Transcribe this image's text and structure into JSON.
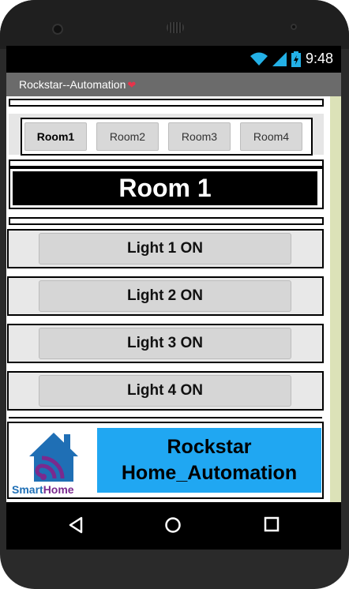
{
  "status": {
    "time": "9:48",
    "icons": [
      "wifi-icon",
      "signal-icon",
      "battery-icon"
    ]
  },
  "app": {
    "title": "Rockstar--Automation",
    "title_icon": "heart-icon"
  },
  "rooms": {
    "tabs": [
      {
        "label": "Room1",
        "active": true
      },
      {
        "label": "Room2",
        "active": false
      },
      {
        "label": "Room3",
        "active": false
      },
      {
        "label": "Room4",
        "active": false
      }
    ],
    "current_title": "Room 1"
  },
  "lights": [
    {
      "label": "Light 1 ON"
    },
    {
      "label": "Light 2 ON"
    },
    {
      "label": "Light 3 ON"
    },
    {
      "label": "Light 4 ON"
    }
  ],
  "footer": {
    "logo_text_smart": "Smart",
    "logo_text_home": "Home",
    "banner_line1": "Rockstar",
    "banner_line2": "Home_Automation"
  },
  "navbar": {
    "icons": [
      "back-icon",
      "home-icon",
      "recents-icon"
    ]
  },
  "colors": {
    "banner": "#20a7f2",
    "title_bar": "#6b6b6b",
    "side_strip": "#dce2b8",
    "heart": "#e8334a",
    "logo_blue": "#1f6fb5",
    "logo_purple": "#7a2a8e"
  }
}
